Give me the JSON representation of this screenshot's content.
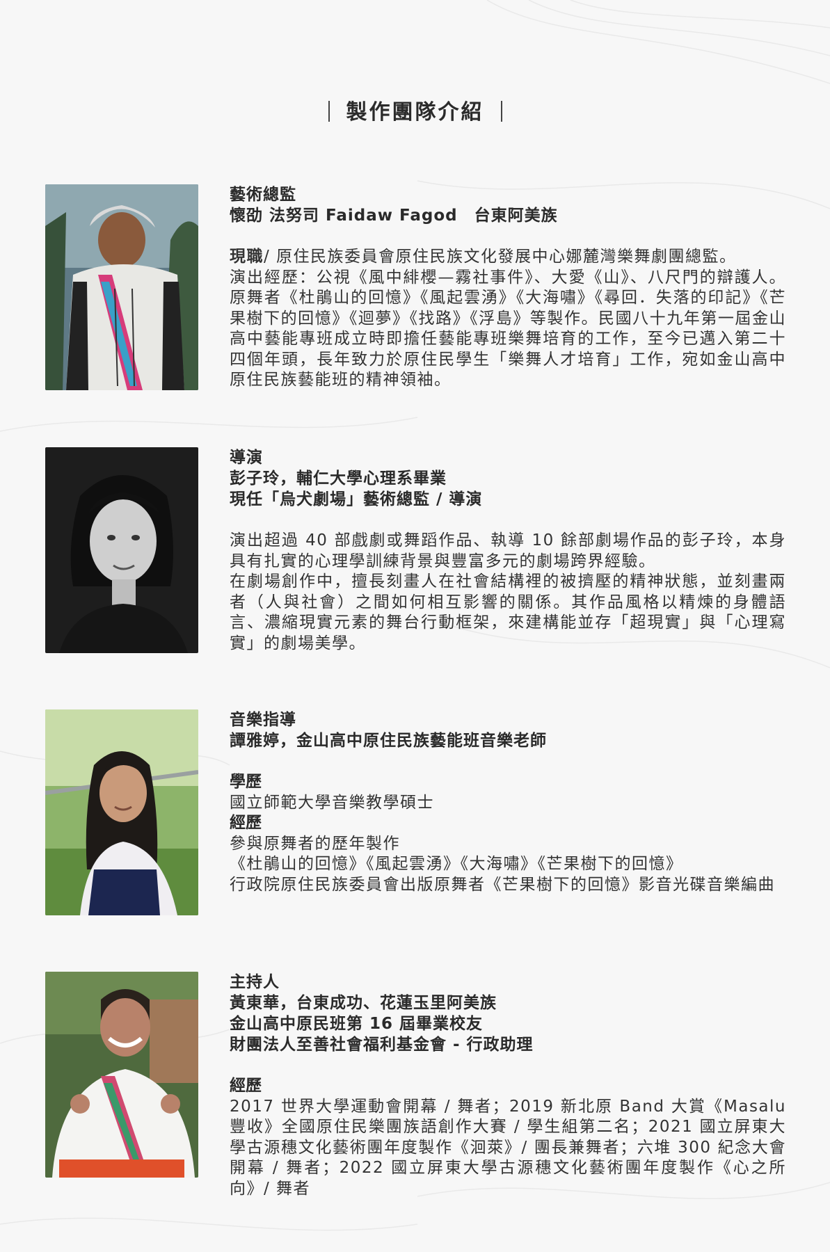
{
  "heading": "製作團隊介紹",
  "members": [
    {
      "role": "藝術總監",
      "name_line": "懷劭 法努司 Faidaw Fagod　台東阿美族",
      "position_label": "現職",
      "position_text": "/ 原住民族委員會原住民族文化發展中心娜麓灣樂舞劇團總監。",
      "bio": "演出經歷：公視《風中緋櫻—霧社事件》、大愛《山》、八尺門的辯護人。原舞者《杜鵑山的回憶》《風起雲湧》《大海嘯》《尋回．失落的印記》《芒果樹下的回憶》《迴夢》《找路》《浮島》等製作。民國八十九年第一屆金山高中藝能專班成立時即擔任藝能專班樂舞培育的工作，至今已邁入第二十四個年頭，長年致力於原住民學生「樂舞人才培育」工作，宛如金山高中原住民族藝能班的精神領袖。"
    },
    {
      "role": "導演",
      "lines": [
        "彭子玲，輔仁大學心理系畢業",
        "現任「烏犬劇場」藝術總監 / 導演"
      ],
      "para1": "演出超過 40 部戲劇或舞蹈作品、執導 10 餘部劇場作品的彭子玲，本身具有扎實的心理學訓練背景與豐富多元的劇場跨界經驗。",
      "para2": "在劇場創作中，擅長刻畫人在社會結構裡的被擠壓的精神狀態，並刻畫兩者（人與社會）之間如何相互影響的關係。其作品風格以精煉的身體語言、濃縮現實元素的舞台行動框架，來建構能並存「超現實」與「心理寫實」的劇場美學。"
    },
    {
      "role": "音樂指導",
      "name_line": "譚雅婷，金山高中原住民族藝能班音樂老師",
      "edu_label": "學歷",
      "edu": "國立師範大學音樂教學碩士",
      "exp_label": "經歷",
      "exp1": "參與原舞者的歷年製作",
      "exp2": "《杜鵑山的回憶》《風起雲湧》《大海嘯》《芒果樹下的回憶》",
      "exp3": "行政院原住民族委員會出版原舞者《芒果樹下的回憶》影音光碟音樂編曲"
    },
    {
      "role": "主持人",
      "lines": [
        "黃東華，台東成功、花蓮玉里阿美族",
        "金山高中原民班第 16 屆畢業校友",
        "財團法人至善社會福利基金會 - 行政助理"
      ],
      "exp_label": "經歷",
      "exp": "2017 世界大學運動會開幕 / 舞者；2019 新北原 Band 大賞《Masalu 豐收》全國原住民樂團族語創作大賽 / 學生組第二名；2021 國立屏東大學古源穗文化藝術團年度製作《洄萊》/ 團長兼舞者；六堆 300 紀念大會開幕 / 舞者；2022 國立屏東大學古源穗文化藝術團年度製作《心之所向》/ 舞者"
    }
  ]
}
